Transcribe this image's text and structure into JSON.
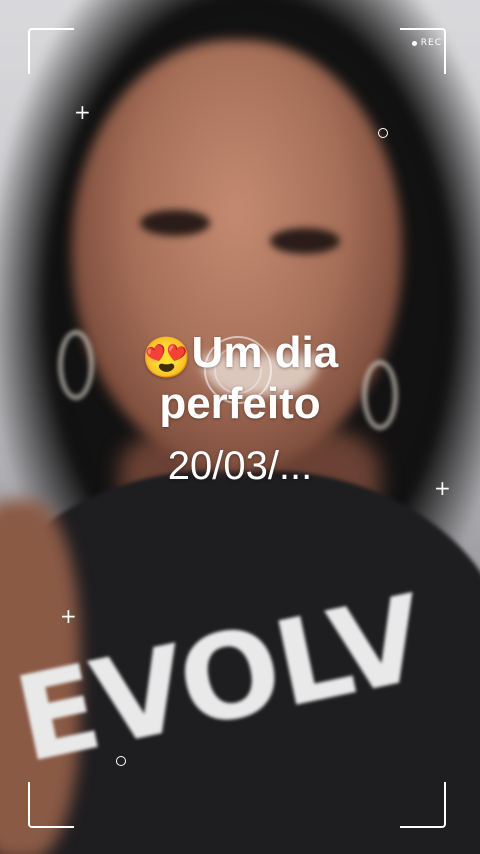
{
  "overlay": {
    "rec_label": "REC",
    "emoji": "😍",
    "title": "Um dia perfeito",
    "date": "20/03/..."
  },
  "scene": {
    "shirt_text": "EVOLV"
  },
  "colors": {
    "overlay": "#ffffff",
    "shirt": "#1e1d20",
    "shirt_text": "#e9e9e9",
    "shirt_accent": "#c43a3a"
  }
}
